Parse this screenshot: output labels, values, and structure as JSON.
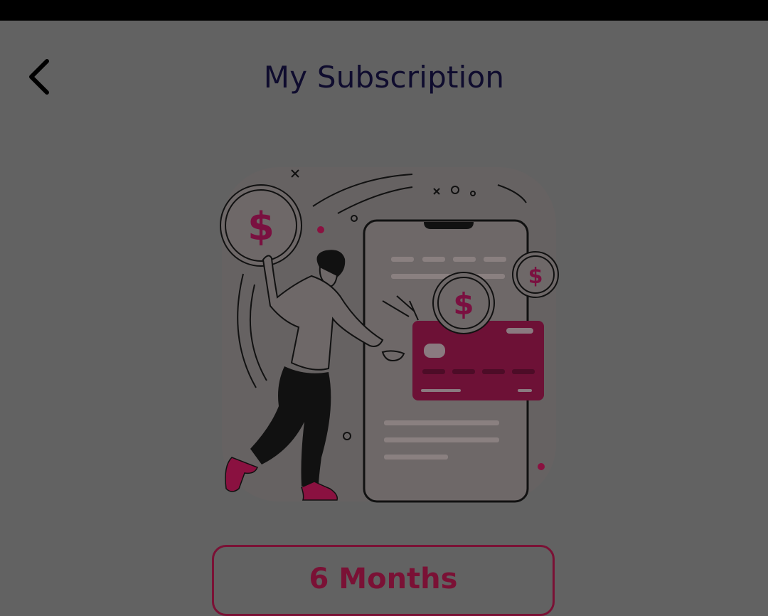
{
  "header": {
    "title": "My Subscription",
    "back_icon": "chevron-left-icon"
  },
  "illustration": {
    "description_icon": "payment-illustration",
    "coin_symbol": "$"
  },
  "plans": [
    {
      "label": "6 Months"
    }
  ],
  "colors": {
    "status_bar": "#000000",
    "background": "#626262",
    "title": "#0f0c2e",
    "accent": "#7a1135"
  }
}
